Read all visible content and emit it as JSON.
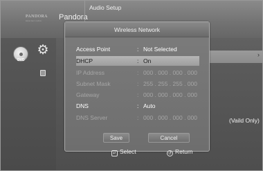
{
  "header": {
    "logo": "PANDORA",
    "logo_sub": "internet radio",
    "pandora": "Pandora",
    "audio_setup": "Audio Setup"
  },
  "sidebar": {
    "dvd": "DVD"
  },
  "dialog": {
    "title": "Wireless Network",
    "rows": [
      {
        "label": "Access Point",
        "sep": ":",
        "value": "Not Selected"
      },
      {
        "label": "DHCP",
        "sep": ":",
        "value": "On"
      },
      {
        "label": "IP Address",
        "sep": ":",
        "value": "000 . 000 . 000 . 000"
      },
      {
        "label": "Subnet Mask",
        "sep": ":",
        "value": "255 . 255 . 255 . 000"
      },
      {
        "label": "Gateway",
        "sep": ":",
        "value": "000 . 000 . 000 . 000"
      },
      {
        "label": "DNS",
        "sep": ":",
        "value": "Auto"
      },
      {
        "label": "DNS Server",
        "sep": ":",
        "value": "000 . 000 . 000 . 000"
      }
    ],
    "save_label": "Save",
    "cancel_label": "Cancel"
  },
  "right_panel": {
    "vaild_only": "(Vaild Only)"
  },
  "footer": {
    "select_label": "Select",
    "return_label": "Return"
  },
  "icons": {
    "gear": "gear-icon",
    "dvd": "dvd-icon",
    "select": "select-icon",
    "return": "return-icon"
  }
}
